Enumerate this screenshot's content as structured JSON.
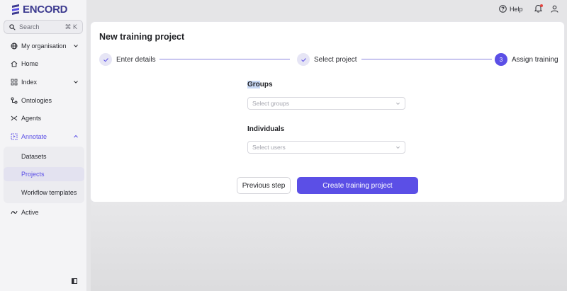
{
  "app": {
    "logo_text": "ENCORD"
  },
  "search": {
    "placeholder": "Search",
    "shortcut": "⌘ K"
  },
  "sidebar": {
    "items": [
      {
        "label": "My organisation",
        "icon": "globe-icon",
        "chevron": "chevron-down"
      },
      {
        "label": "Home",
        "icon": "home-icon"
      },
      {
        "label": "Index",
        "icon": "index-icon",
        "chevron": "chevron-down"
      },
      {
        "label": "Ontologies",
        "icon": "ontology-icon"
      },
      {
        "label": "Agents",
        "icon": "agents-icon"
      },
      {
        "label": "Annotate",
        "icon": "annotate-icon",
        "chevron": "chevron-up",
        "expanded": true
      },
      {
        "label": "Datasets"
      },
      {
        "label": "Projects",
        "selected": true
      },
      {
        "label": "Workflow templates"
      },
      {
        "label": "Active",
        "icon": "active-icon"
      }
    ]
  },
  "topbar": {
    "help_label": "Help"
  },
  "main": {
    "title": "New training project",
    "steps": [
      {
        "label": "Enter details",
        "state": "done"
      },
      {
        "label": "Select project",
        "state": "done"
      },
      {
        "number": "3",
        "label": "Assign training",
        "state": "current"
      }
    ],
    "groups": {
      "label_highlight": "Gro",
      "label_rest": "ups",
      "placeholder": "Select groups"
    },
    "individuals": {
      "label": "Individuals",
      "placeholder": "Select users"
    },
    "buttons": {
      "previous": "Previous step",
      "create": "Create training project"
    }
  },
  "colors": {
    "accent": "#5b4fe6",
    "logo": "#3c3a8f",
    "notification": "#e4443f"
  }
}
